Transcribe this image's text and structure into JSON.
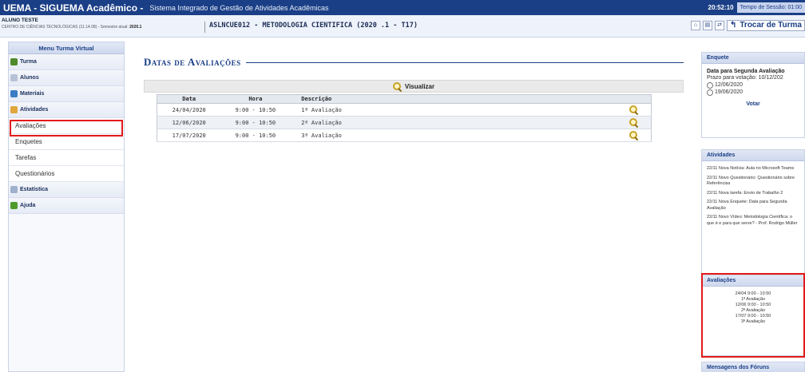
{
  "header": {
    "brand": "UEMA - SIGUEMA Acadêmico -",
    "subtitle": "Sistema Integrado de Gestão de Atividades Acadêmicas",
    "clock": "20:52:10",
    "session_label": "Tempo de Sessão: 01:00"
  },
  "infobar": {
    "student_name": "ALUNO TESTE",
    "unit": "CENTRO DE CIÊNCIAS TECNOLÓGICAS (11.14.08) - Semestre atual:",
    "semester": "2020.1",
    "course": "ASLNCUE012 - METODOLOGIA CIENTIFICA (2020 .1 - T17)",
    "swap_label": "Trocar de Turma",
    "tools": [
      "home-icon",
      "print-icon",
      "link-icon"
    ]
  },
  "sidebar": {
    "title": "Menu Turma Virtual",
    "items": [
      {
        "label": "Turma",
        "icon": "people-icon",
        "color": "#4f8a2b"
      },
      {
        "label": "Alunos",
        "icon": "students-icon",
        "color": "#b8c2d6"
      },
      {
        "label": "Materiais",
        "icon": "materials-icon",
        "color": "#3b7dc4"
      },
      {
        "label": "Atividades",
        "icon": "folder-icon",
        "color": "#e0a63a"
      }
    ],
    "sub_items": [
      "Avaliações",
      "Enquetes",
      "Tarefas",
      "Questionários"
    ],
    "items_after": [
      {
        "label": "Estatística",
        "icon": "stats-icon",
        "color": "#9fb0cc"
      },
      {
        "label": "Ajuda",
        "icon": "help-icon",
        "color": "#4f9a2b"
      }
    ]
  },
  "main": {
    "title": "Datas de Avaliações",
    "view_label": "Visualizar",
    "columns": [
      "Data",
      "Hora",
      "Descrição"
    ],
    "rows": [
      {
        "date": "24/04/2020",
        "hora": "9:00 - 10:50",
        "desc": "1ª Avaliação"
      },
      {
        "date": "12/06/2020",
        "hora": "9:00 - 10:50",
        "desc": "2ª Avaliação"
      },
      {
        "date": "17/07/2020",
        "hora": "9:00 - 10:50",
        "desc": "3ª Avaliação"
      }
    ]
  },
  "right": {
    "poll": {
      "title": "Enquete",
      "question": "Data para Segunda Avaliação",
      "deadline": "Prazo para votação: 10/12/202",
      "options": [
        "12/06/2020",
        "19/06/2020"
      ],
      "vote_label": "Votar"
    },
    "activities": {
      "title": "Atividades",
      "items": [
        "22/11 Nova Notícia: Aula no Microsoft Teams",
        "22/11 Novo Questionário: Questionário sobre Referências",
        "22/11 Nova tarefa: Envio de Trabalho 2",
        "22/11 Nova Enquete: Data para Segunda Avaliação",
        "22/11 Novo Vídeo: Metodologia Científica: o que é e para que serve? - Prof. Rodrigo Müller"
      ]
    },
    "evaluations": {
      "title": "Avaliações",
      "items": [
        {
          "when": "24/04 9:00 - 10:50",
          "name": "1ª Avaliação"
        },
        {
          "when": "12/06 9:00 - 10:50",
          "name": "2ª Avaliação"
        },
        {
          "when": "17/07 9:00 - 10:50",
          "name": "3ª Avaliação"
        }
      ]
    },
    "forum_title": "Mensagens dos Fóruns"
  },
  "colors": {
    "header_bg": "#1b3f86",
    "accent": "#1b3f86",
    "highlight": "#e21a1a"
  }
}
